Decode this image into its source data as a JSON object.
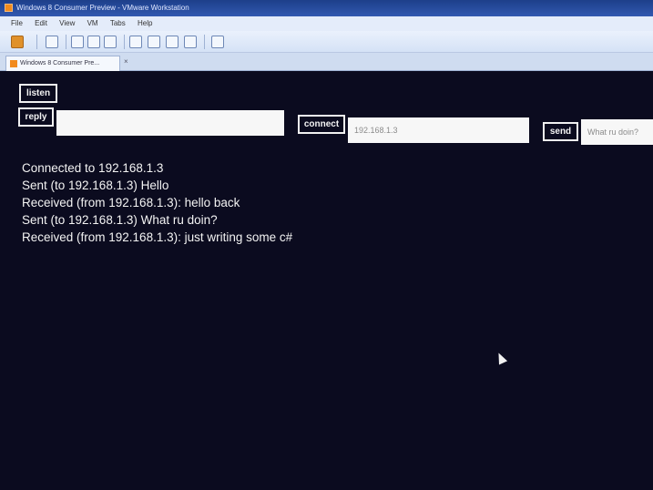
{
  "window": {
    "title": "Windows 8 Consumer Preview - VMware Workstation"
  },
  "menubar": {
    "items": [
      "File",
      "Edit",
      "View",
      "VM",
      "Tabs",
      "Help"
    ]
  },
  "toolbar": {
    "icons": [
      "power-icon",
      "snapshot-icon",
      "revert-icon",
      "manage-snapshots-icon",
      "console-icon",
      "fullscreen-icon",
      "unity-icon",
      "settings-icon",
      "thumbnail-icon"
    ]
  },
  "tabs": [
    {
      "label": "Windows 8 Consumer Pre...",
      "close": "×"
    }
  ],
  "app": {
    "listen_label": "listen",
    "reply_label": "reply",
    "connect_label": "connect",
    "send_label": "send",
    "reply_value": "",
    "ip_value": "192.168.1.3",
    "message_value": "What ru doin?",
    "log": [
      "Connected to 192.168.1.3",
      "Sent (to 192.168.1.3) Hello",
      "Received (from 192.168.1.3): hello back",
      "Sent (to 192.168.1.3) What ru doin?",
      "Received (from 192.168.1.3): just writing some c#"
    ]
  },
  "colors": {
    "app_background": "#0b0b1f",
    "titlebar": "#3158b0",
    "text": "#f3f3f3"
  }
}
